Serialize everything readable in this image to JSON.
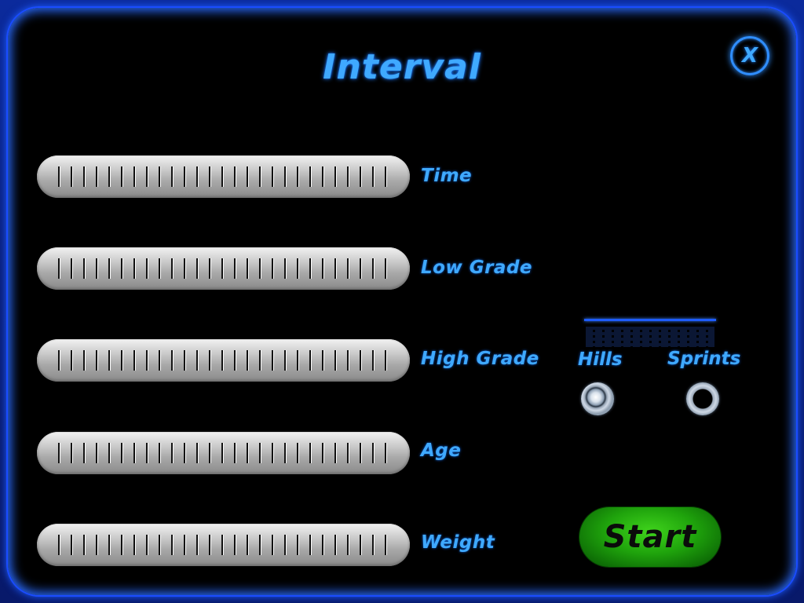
{
  "title": "Interval",
  "close_button": {
    "label": "X"
  },
  "sliders": [
    {
      "label": "Time"
    },
    {
      "label": "Low Grade"
    },
    {
      "label": "High Grade"
    },
    {
      "label": "Age"
    },
    {
      "label": "Weight"
    }
  ],
  "mode_options": {
    "hills": {
      "label": "Hills",
      "selected": true
    },
    "sprints": {
      "label": "Sprints",
      "selected": false
    }
  },
  "start_button": {
    "label": "Start"
  },
  "colors": {
    "accent": "#3fa9ff",
    "frame": "#1a4cff",
    "start_green": "#1fa30c"
  }
}
